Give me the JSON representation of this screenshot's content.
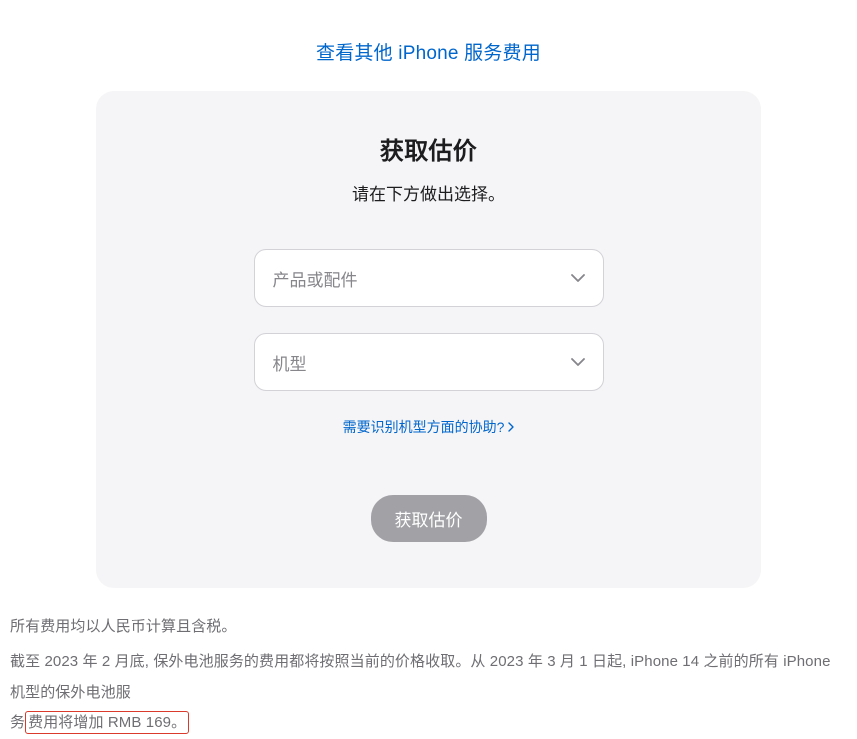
{
  "top_link": "查看其他 iPhone 服务费用",
  "card": {
    "title": "获取估价",
    "subtitle": "请在下方做出选择。",
    "product_placeholder": "产品或配件",
    "model_placeholder": "机型",
    "help_text": "需要识别机型方面的协助?",
    "button": "获取估价"
  },
  "footer": {
    "line1": "所有费用均以人民币计算且含税。",
    "line2_a": "截至 2023 年 2 月底, 保外电池服务的费用都将按照当前的价格收取。从 2023 年 3 月 1 日起, iPhone 14 之前的所有 iPhone 机型的保外电池服",
    "line2_b_pre": "务",
    "line2_b_hl": "费用将增加 RMB 169。"
  }
}
